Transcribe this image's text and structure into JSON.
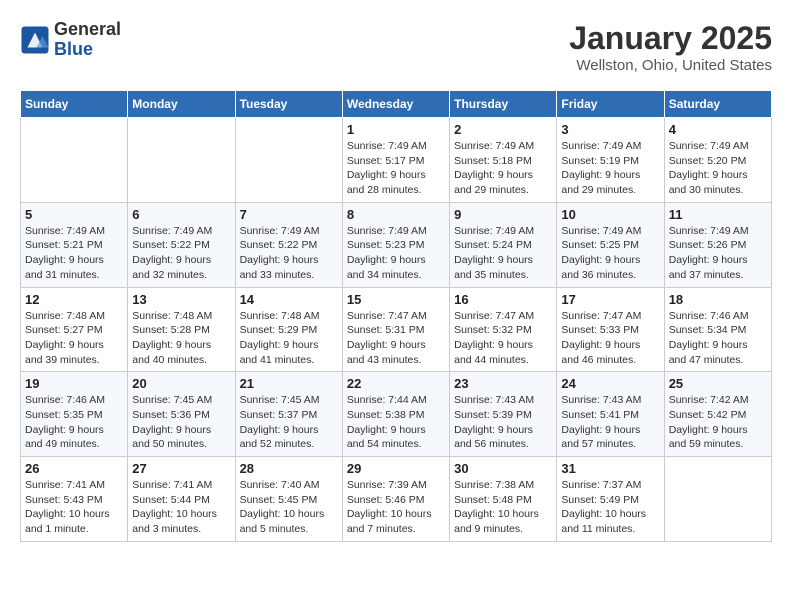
{
  "logo": {
    "general": "General",
    "blue": "Blue"
  },
  "title": "January 2025",
  "location": "Wellston, Ohio, United States",
  "days_of_week": [
    "Sunday",
    "Monday",
    "Tuesday",
    "Wednesday",
    "Thursday",
    "Friday",
    "Saturday"
  ],
  "weeks": [
    [
      {
        "day": "",
        "detail": ""
      },
      {
        "day": "",
        "detail": ""
      },
      {
        "day": "",
        "detail": ""
      },
      {
        "day": "1",
        "detail": "Sunrise: 7:49 AM\nSunset: 5:17 PM\nDaylight: 9 hours and 28 minutes."
      },
      {
        "day": "2",
        "detail": "Sunrise: 7:49 AM\nSunset: 5:18 PM\nDaylight: 9 hours and 29 minutes."
      },
      {
        "day": "3",
        "detail": "Sunrise: 7:49 AM\nSunset: 5:19 PM\nDaylight: 9 hours and 29 minutes."
      },
      {
        "day": "4",
        "detail": "Sunrise: 7:49 AM\nSunset: 5:20 PM\nDaylight: 9 hours and 30 minutes."
      }
    ],
    [
      {
        "day": "5",
        "detail": "Sunrise: 7:49 AM\nSunset: 5:21 PM\nDaylight: 9 hours and 31 minutes."
      },
      {
        "day": "6",
        "detail": "Sunrise: 7:49 AM\nSunset: 5:22 PM\nDaylight: 9 hours and 32 minutes."
      },
      {
        "day": "7",
        "detail": "Sunrise: 7:49 AM\nSunset: 5:22 PM\nDaylight: 9 hours and 33 minutes."
      },
      {
        "day": "8",
        "detail": "Sunrise: 7:49 AM\nSunset: 5:23 PM\nDaylight: 9 hours and 34 minutes."
      },
      {
        "day": "9",
        "detail": "Sunrise: 7:49 AM\nSunset: 5:24 PM\nDaylight: 9 hours and 35 minutes."
      },
      {
        "day": "10",
        "detail": "Sunrise: 7:49 AM\nSunset: 5:25 PM\nDaylight: 9 hours and 36 minutes."
      },
      {
        "day": "11",
        "detail": "Sunrise: 7:49 AM\nSunset: 5:26 PM\nDaylight: 9 hours and 37 minutes."
      }
    ],
    [
      {
        "day": "12",
        "detail": "Sunrise: 7:48 AM\nSunset: 5:27 PM\nDaylight: 9 hours and 39 minutes."
      },
      {
        "day": "13",
        "detail": "Sunrise: 7:48 AM\nSunset: 5:28 PM\nDaylight: 9 hours and 40 minutes."
      },
      {
        "day": "14",
        "detail": "Sunrise: 7:48 AM\nSunset: 5:29 PM\nDaylight: 9 hours and 41 minutes."
      },
      {
        "day": "15",
        "detail": "Sunrise: 7:47 AM\nSunset: 5:31 PM\nDaylight: 9 hours and 43 minutes."
      },
      {
        "day": "16",
        "detail": "Sunrise: 7:47 AM\nSunset: 5:32 PM\nDaylight: 9 hours and 44 minutes."
      },
      {
        "day": "17",
        "detail": "Sunrise: 7:47 AM\nSunset: 5:33 PM\nDaylight: 9 hours and 46 minutes."
      },
      {
        "day": "18",
        "detail": "Sunrise: 7:46 AM\nSunset: 5:34 PM\nDaylight: 9 hours and 47 minutes."
      }
    ],
    [
      {
        "day": "19",
        "detail": "Sunrise: 7:46 AM\nSunset: 5:35 PM\nDaylight: 9 hours and 49 minutes."
      },
      {
        "day": "20",
        "detail": "Sunrise: 7:45 AM\nSunset: 5:36 PM\nDaylight: 9 hours and 50 minutes."
      },
      {
        "day": "21",
        "detail": "Sunrise: 7:45 AM\nSunset: 5:37 PM\nDaylight: 9 hours and 52 minutes."
      },
      {
        "day": "22",
        "detail": "Sunrise: 7:44 AM\nSunset: 5:38 PM\nDaylight: 9 hours and 54 minutes."
      },
      {
        "day": "23",
        "detail": "Sunrise: 7:43 AM\nSunset: 5:39 PM\nDaylight: 9 hours and 56 minutes."
      },
      {
        "day": "24",
        "detail": "Sunrise: 7:43 AM\nSunset: 5:41 PM\nDaylight: 9 hours and 57 minutes."
      },
      {
        "day": "25",
        "detail": "Sunrise: 7:42 AM\nSunset: 5:42 PM\nDaylight: 9 hours and 59 minutes."
      }
    ],
    [
      {
        "day": "26",
        "detail": "Sunrise: 7:41 AM\nSunset: 5:43 PM\nDaylight: 10 hours and 1 minute."
      },
      {
        "day": "27",
        "detail": "Sunrise: 7:41 AM\nSunset: 5:44 PM\nDaylight: 10 hours and 3 minutes."
      },
      {
        "day": "28",
        "detail": "Sunrise: 7:40 AM\nSunset: 5:45 PM\nDaylight: 10 hours and 5 minutes."
      },
      {
        "day": "29",
        "detail": "Sunrise: 7:39 AM\nSunset: 5:46 PM\nDaylight: 10 hours and 7 minutes."
      },
      {
        "day": "30",
        "detail": "Sunrise: 7:38 AM\nSunset: 5:48 PM\nDaylight: 10 hours and 9 minutes."
      },
      {
        "day": "31",
        "detail": "Sunrise: 7:37 AM\nSunset: 5:49 PM\nDaylight: 10 hours and 11 minutes."
      },
      {
        "day": "",
        "detail": ""
      }
    ]
  ]
}
